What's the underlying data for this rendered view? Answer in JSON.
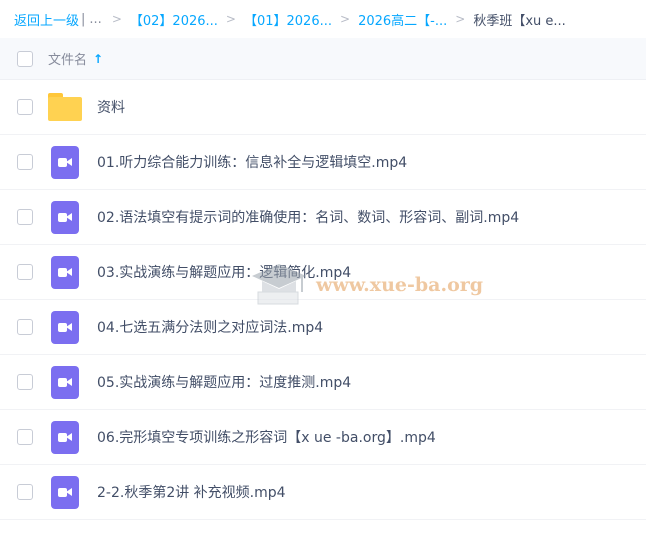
{
  "breadcrumb": {
    "back": "返回上一级",
    "ellipsis": "...",
    "items": [
      "【02】2026...",
      "【01】2026...",
      "2026高二【-..."
    ],
    "current": "秋季班【xu e..."
  },
  "header": {
    "column_title": "文件名",
    "sort_icon": "arrow-up-icon"
  },
  "files": [
    {
      "name": "资料",
      "type": "folder"
    },
    {
      "name": "01.听力综合能力训练：信息补全与逻辑填空.mp4",
      "type": "video"
    },
    {
      "name": "02.语法填空有提示词的准确使用：名词、数词、形容词、副词.mp4",
      "type": "video"
    },
    {
      "name": "03.实战演练与解题应用：逻辑简化.mp4",
      "type": "video"
    },
    {
      "name": "04.七选五满分法则之对应词法.mp4",
      "type": "video"
    },
    {
      "name": "05.实战演练与解题应用：过度推测.mp4",
      "type": "video"
    },
    {
      "name": "06.完形填空专项训练之形容词【x ue -ba.org】.mp4",
      "type": "video"
    },
    {
      "name": "2-2.秋季第2讲 补充视频.mp4",
      "type": "video"
    }
  ],
  "watermark": {
    "text": "www.xue-ba.org"
  },
  "colors": {
    "accent": "#06a7ff",
    "folder": "#ffd251",
    "video": "#7b6ef0"
  }
}
